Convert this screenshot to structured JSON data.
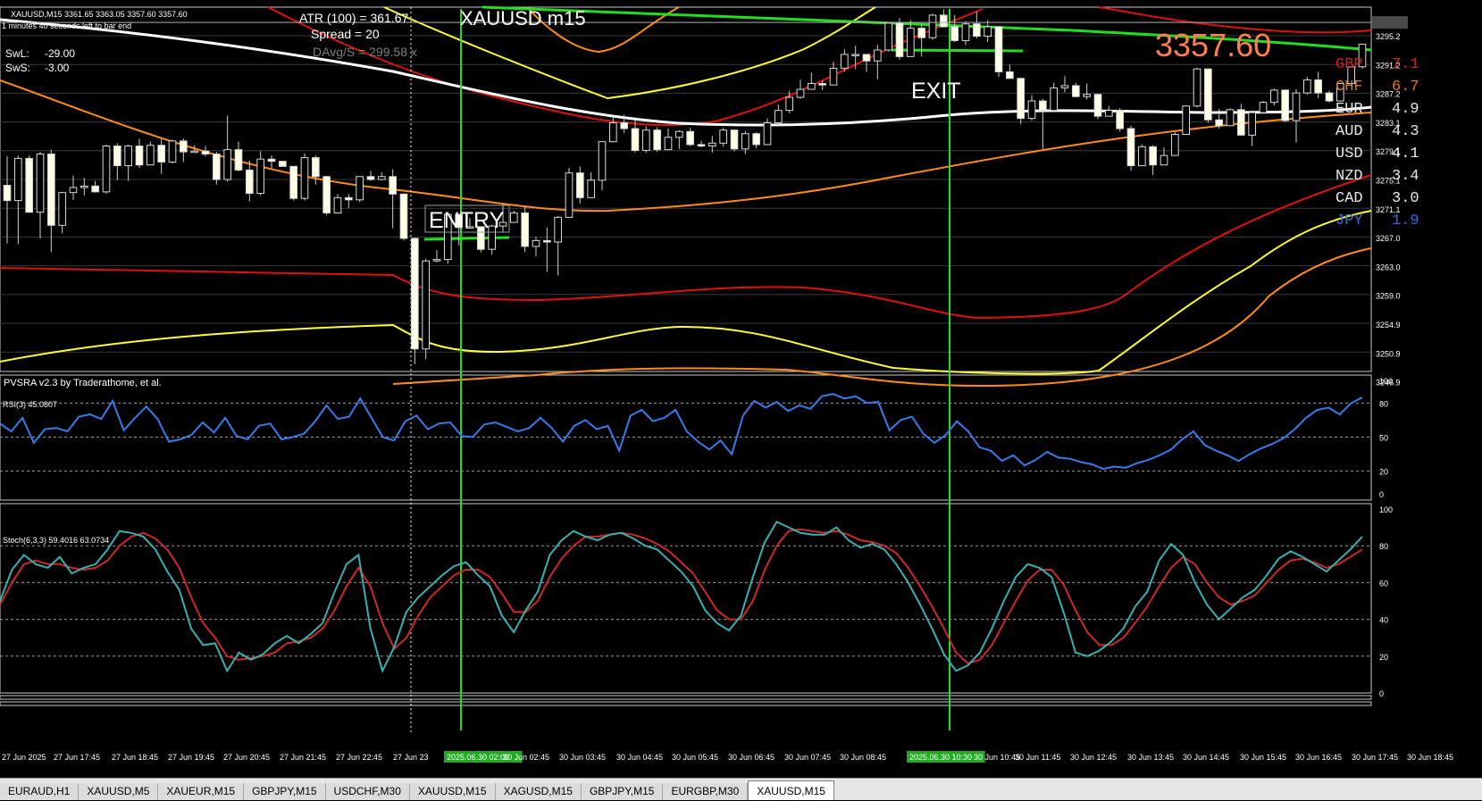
{
  "window": {
    "symbol_header": "XAUUSD,M15  3361.65 3363.05 3357.60 3357.60",
    "bar_timer": "1 minutes 40 seconds left to bar end",
    "big_title": "XAUUSD m15",
    "last_price": "3357.60",
    "indicator_credit": "PVSRA v2.3 by Traderathome, et al."
  },
  "stats": {
    "atr": "ATR (100) = 361.67",
    "spread": "Spread = 20",
    "davg": "DAvg/S = 299.58 x",
    "swl_label": "SwL:",
    "swl_value": "-29.00",
    "sws_label": "SwS:",
    "sws_value": "-3.00"
  },
  "trade_labels": {
    "entry": "ENTRY",
    "exit": "EXIT"
  },
  "currency_strength": [
    {
      "code": "GBP",
      "value": "7.1",
      "color": "#d12020"
    },
    {
      "code": "CHF",
      "value": "6.7",
      "color": "#e07820"
    },
    {
      "code": "EUR",
      "value": "4.9",
      "color": "#e8e8e8"
    },
    {
      "code": "AUD",
      "value": "4.3",
      "color": "#e8e8e8"
    },
    {
      "code": "USD",
      "value": "4.1",
      "color": "#e8e8e8"
    },
    {
      "code": "NZD",
      "value": "3.4",
      "color": "#e8e8e8"
    },
    {
      "code": "CAD",
      "value": "3.0",
      "color": "#e8e8e8"
    },
    {
      "code": "JPY",
      "value": "1.9",
      "color": "#3a6ae0"
    }
  ],
  "price_axis": [
    "3295.2",
    "3291.2",
    "3287.2",
    "3283.1",
    "3279.1",
    "3275.1",
    "3271.1",
    "3267.0",
    "3263.0",
    "3259.0",
    "3254.9",
    "3250.9",
    "3246.9"
  ],
  "rsi": {
    "label": "RSI(3) 45.0807",
    "levels": [
      "100",
      "80",
      "50",
      "20",
      "0"
    ]
  },
  "stoch": {
    "label": "Stoch(6,3,3) 59.4016 63.0734",
    "levels": [
      "100",
      "80",
      "60",
      "40",
      "20",
      "0"
    ]
  },
  "time_axis": [
    "27 Jun 2025",
    "27 Jun 17:45",
    "27 Jun 18:45",
    "27 Jun 19:45",
    "27 Jun 20:45",
    "27 Jun 21:45",
    "27 Jun 22:45",
    "27 Jun 23",
    "2025.06.30 02:00",
    "30 Jun 02:45",
    "30 Jun 03:45",
    "30 Jun 04:45",
    "30 Jun 05:45",
    "30 Jun 06:45",
    "30 Jun 07:45",
    "30 Jun 08:45",
    "2025.06.30 10:30",
    "30 Jun 10:45",
    "30 Jun 11:45",
    "30 Jun 12:45",
    "30 Jun 13:45",
    "30 Jun 14:45",
    "30 Jun 15:45",
    "30 Jun 16:45",
    "30 Jun 17:45",
    "30 Jun 18:45"
  ],
  "tabs": [
    "EURAUD,H1",
    "XAUUSD,M5",
    "XAUEUR,M15",
    "GBPJPY,M15",
    "USDCHF,M30",
    "XAUUSD,M15",
    "XAGUSD,M15",
    "GBPJPY,M15",
    "EURGBP,M30",
    "XAUUSD,M15"
  ],
  "active_tab": 9,
  "chart_data": {
    "type": "candlestick",
    "instrument": "XAUUSD",
    "timeframe": "M15",
    "ylim": [
      3246.9,
      3297.0
    ],
    "candles": [
      [
        3272.5,
        3276.5,
        3264.5,
        3270.4
      ],
      [
        3270.4,
        3276.6,
        3264.4,
        3276.2
      ],
      [
        3276.2,
        3276.6,
        3268.7,
        3268.8
      ],
      [
        3268.8,
        3277.1,
        3265.2,
        3276.8
      ],
      [
        3276.8,
        3277.4,
        3263.3,
        3267.0
      ],
      [
        3267.0,
        3271.6,
        3265.9,
        3271.5
      ],
      [
        3271.5,
        3273.8,
        3270.5,
        3272.2
      ],
      [
        3272.2,
        3273.5,
        3271.1,
        3272.4
      ],
      [
        3272.4,
        3273.1,
        3271.5,
        3271.6
      ],
      [
        3271.6,
        3278.1,
        3271.3,
        3277.9
      ],
      [
        3277.9,
        3278.3,
        3273.2,
        3275.2
      ],
      [
        3275.2,
        3278.1,
        3273.1,
        3277.9
      ],
      [
        3277.9,
        3278.9,
        3274.9,
        3275.3
      ],
      [
        3275.3,
        3278.5,
        3276.5,
        3278.0
      ],
      [
        3278.0,
        3278.9,
        3274.1,
        3275.7
      ],
      [
        3275.7,
        3278.8,
        3275.5,
        3278.6
      ],
      [
        3278.6,
        3278.9,
        3275.7,
        3277.1
      ],
      [
        3277.1,
        3278.0,
        3277.0,
        3277.2
      ],
      [
        3277.2,
        3277.9,
        3276.5,
        3276.8
      ],
      [
        3276.8,
        3277.1,
        3272.6,
        3273.3
      ],
      [
        3273.3,
        3282.1,
        3273.0,
        3277.4
      ],
      [
        3277.4,
        3278.5,
        3274.4,
        3274.6
      ],
      [
        3274.6,
        3275.9,
        3270.3,
        3271.4
      ],
      [
        3271.4,
        3277.2,
        3271.1,
        3276.1
      ],
      [
        3276.1,
        3276.6,
        3274.8,
        3275.8
      ],
      [
        3275.8,
        3275.7,
        3275.2,
        3275.1
      ],
      [
        3275.1,
        3275.1,
        3270.4,
        3270.7
      ],
      [
        3270.7,
        3276.9,
        3270.4,
        3276.3
      ],
      [
        3276.3,
        3276.6,
        3272.6,
        3273.7
      ],
      [
        3273.7,
        3273.8,
        3268.4,
        3268.7
      ],
      [
        3268.7,
        3271.3,
        3270.2,
        3270.8
      ],
      [
        3270.8,
        3271.3,
        3269.4,
        3270.5
      ],
      [
        3270.5,
        3273.7,
        3270.2,
        3273.7
      ],
      [
        3273.7,
        3274.5,
        3273.1,
        3273.3
      ],
      [
        3273.3,
        3274.3,
        3273.2,
        3273.7
      ],
      [
        3273.7,
        3274.7,
        3266.6,
        3271.3
      ],
      [
        3271.3,
        3271.3,
        3264.9,
        3265.2
      ],
      [
        3265.2,
        3265.3,
        3247.9,
        3250.0
      ],
      [
        3250.0,
        3262.4,
        3248.6,
        3262.1
      ],
      [
        3262.1,
        3263.6,
        3261.9,
        3262.3
      ],
      [
        3262.3,
        3268.6,
        3261.7,
        3268.5
      ],
      [
        3268.5,
        3267.1,
        3264.2,
        3266.7
      ],
      [
        3266.7,
        3268.0,
        3266.6,
        3266.8
      ],
      [
        3266.8,
        3266.7,
        3263.3,
        3263.7
      ],
      [
        3263.7,
        3267.1,
        3263.0,
        3266.9
      ],
      [
        3266.9,
        3269.9,
        3266.1,
        3267.4
      ],
      [
        3267.4,
        3269.0,
        3267.8,
        3268.7
      ],
      [
        3268.7,
        3269.7,
        3263.3,
        3264.1
      ],
      [
        3264.1,
        3265.4,
        3262.8,
        3264.9
      ],
      [
        3264.9,
        3266.7,
        3260.6,
        3264.7
      ],
      [
        3264.7,
        3268.3,
        3260.1,
        3268.1
      ],
      [
        3268.1,
        3274.9,
        3268.1,
        3274.2
      ],
      [
        3274.2,
        3275.1,
        3270.0,
        3270.8
      ],
      [
        3270.8,
        3274.3,
        3271.1,
        3273.2
      ],
      [
        3273.2,
        3278.5,
        3271.8,
        3278.5
      ],
      [
        3278.5,
        3282.1,
        3278.4,
        3281.1
      ],
      [
        3281.1,
        3282.2,
        3279.7,
        3280.3
      ],
      [
        3280.3,
        3281.5,
        3277.0,
        3277.3
      ],
      [
        3277.3,
        3280.6,
        3277.0,
        3280.1
      ],
      [
        3280.1,
        3280.5,
        3277.1,
        3277.4
      ],
      [
        3277.4,
        3280.3,
        3277.8,
        3279.1
      ],
      [
        3279.1,
        3280.1,
        3277.5,
        3279.9
      ],
      [
        3279.9,
        3280.4,
        3277.9,
        3278.1
      ],
      [
        3278.1,
        3278.6,
        3277.7,
        3277.9
      ],
      [
        3277.9,
        3279.3,
        3277.0,
        3278.3
      ],
      [
        3278.3,
        3280.4,
        3277.8,
        3280.1
      ],
      [
        3280.1,
        3279.3,
        3277.2,
        3277.5
      ],
      [
        3277.5,
        3280.0,
        3276.8,
        3279.6
      ],
      [
        3279.6,
        3279.8,
        3277.6,
        3278.1
      ],
      [
        3278.1,
        3281.7,
        3278.3,
        3281.1
      ],
      [
        3281.1,
        3283.6,
        3280.7,
        3282.8
      ],
      [
        3282.8,
        3285.5,
        3282.4,
        3284.6
      ],
      [
        3284.6,
        3287.0,
        3284.4,
        3285.7
      ],
      [
        3285.7,
        3288.0,
        3286.0,
        3286.5
      ],
      [
        3286.5,
        3286.9,
        3285.6,
        3286.3
      ],
      [
        3286.3,
        3289.5,
        3286.3,
        3288.6
      ],
      [
        3288.6,
        3291.2,
        3288.1,
        3290.5
      ],
      [
        3290.5,
        3291.7,
        3288.5,
        3290.5
      ],
      [
        3290.5,
        3290.4,
        3288.1,
        3289.6
      ],
      [
        3289.6,
        3291.8,
        3287.1,
        3291.1
      ],
      [
        3291.1,
        3294.9,
        3290.9,
        3294.8
      ],
      [
        3294.8,
        3295.5,
        3289.8,
        3290.2
      ],
      [
        3290.2,
        3295.2,
        3290.6,
        3294.1
      ],
      [
        3294.1,
        3294.6,
        3290.2,
        3292.8
      ],
      [
        3292.8,
        3296.1,
        3292.5,
        3295.9
      ],
      [
        3295.9,
        3296.7,
        3294.2,
        3294.3
      ],
      [
        3294.3,
        3295.9,
        3292.2,
        3292.4
      ],
      [
        3292.4,
        3295.1,
        3291.8,
        3294.7
      ],
      [
        3294.7,
        3296.4,
        3292.7,
        3293.0
      ],
      [
        3293.0,
        3295.2,
        3292.2,
        3294.3
      ],
      [
        3294.3,
        3292.8,
        3287.4,
        3288.1
      ],
      [
        3288.1,
        3289.1,
        3287.3,
        3287.2
      ],
      [
        3287.2,
        3287.3,
        3280.9,
        3281.7
      ],
      [
        3281.7,
        3284.9,
        3281.4,
        3284.1
      ],
      [
        3284.1,
        3284.4,
        3277.5,
        3282.8
      ],
      [
        3282.8,
        3286.6,
        3282.6,
        3285.9
      ],
      [
        3285.9,
        3287.5,
        3285.3,
        3286.2
      ],
      [
        3286.2,
        3286.6,
        3284.6,
        3284.7
      ],
      [
        3284.7,
        3286.5,
        3284.3,
        3285.0
      ],
      [
        3285.0,
        3285.1,
        3281.6,
        3282.0
      ],
      [
        3282.0,
        3283.4,
        3282.1,
        3282.8
      ],
      [
        3282.8,
        3283.1,
        3279.9,
        3280.3
      ],
      [
        3280.3,
        3280.7,
        3274.5,
        3275.2
      ],
      [
        3275.2,
        3278.1,
        3275.3,
        3277.8
      ],
      [
        3277.8,
        3278.0,
        3273.9,
        3275.3
      ],
      [
        3275.3,
        3277.7,
        3275.4,
        3276.6
      ],
      [
        3276.6,
        3279.8,
        3276.7,
        3279.5
      ],
      [
        3279.5,
        3283.5,
        3279.5,
        3283.4
      ],
      [
        3283.4,
        3288.7,
        3283.2,
        3288.5
      ],
      [
        3288.5,
        3286.4,
        3281.1,
        3281.5
      ],
      [
        3281.5,
        3283.0,
        3280.3,
        3280.7
      ],
      [
        3280.7,
        3283.1,
        3280.6,
        3282.9
      ],
      [
        3282.9,
        3283.7,
        3279.4,
        3279.4
      ],
      [
        3279.4,
        3282.8,
        3277.9,
        3282.5
      ],
      [
        3282.5,
        3284.1,
        3282.4,
        3283.9
      ],
      [
        3283.9,
        3285.8,
        3283.5,
        3285.6
      ],
      [
        3285.6,
        3285.6,
        3281.2,
        3281.4
      ],
      [
        3281.4,
        3285.7,
        3278.4,
        3285.2
      ],
      [
        3285.2,
        3287.4,
        3285.0,
        3287.0
      ],
      [
        3287.0,
        3288.1,
        3284.5,
        3285.2
      ],
      [
        3285.2,
        3285.5,
        3283.9,
        3284.1
      ],
      [
        3284.1,
        3286.6,
        3284.0,
        3286.5
      ],
      [
        3286.5,
        3288.9,
        3286.4,
        3288.8
      ],
      [
        3288.8,
        3291.9,
        3288.5,
        3291.9
      ]
    ],
    "rsi_values": [
      62,
      55,
      67,
      45,
      57,
      58,
      55,
      68,
      70,
      66,
      82,
      56,
      67,
      77,
      66,
      46,
      48,
      52,
      63,
      54,
      67,
      51,
      48,
      60,
      62,
      48,
      50,
      53,
      64,
      78,
      66,
      68,
      84,
      67,
      50,
      47,
      64,
      69,
      57,
      62,
      63,
      51,
      50,
      61,
      63,
      59,
      55,
      58,
      67,
      58,
      46,
      60,
      65,
      57,
      60,
      38,
      69,
      74,
      64,
      67,
      74,
      55,
      46,
      39,
      47,
      35,
      69,
      82,
      76,
      81,
      73,
      78,
      75,
      86,
      88,
      84,
      86,
      80,
      81,
      56,
      65,
      68,
      53,
      45,
      52,
      64,
      55,
      41,
      38,
      29,
      34,
      25,
      30,
      37,
      32,
      31,
      28,
      26,
      22,
      24,
      23,
      27,
      30,
      34,
      39,
      48,
      55,
      43,
      38,
      34,
      29,
      35,
      40,
      44,
      49,
      57,
      67,
      74,
      76,
      70,
      80,
      85
    ],
    "stoch_main": [
      50,
      67,
      75,
      70,
      68,
      74,
      65,
      68,
      70,
      78,
      88,
      87,
      85,
      78,
      66,
      56,
      35,
      26,
      27,
      12,
      22,
      18,
      21,
      27,
      31,
      27,
      32,
      38,
      55,
      70,
      75,
      35,
      12,
      25,
      44,
      52,
      58,
      64,
      69,
      71,
      64,
      58,
      42,
      33,
      45,
      55,
      75,
      83,
      88,
      85,
      83,
      86,
      87,
      84,
      80,
      78,
      72,
      66,
      58,
      45,
      38,
      34,
      42,
      63,
      82,
      93,
      90,
      87,
      86,
      86,
      90,
      83,
      79,
      81,
      78,
      70,
      60,
      48,
      35,
      21,
      12,
      15,
      22,
      35,
      50,
      63,
      70,
      68,
      63,
      44,
      22,
      20,
      23,
      28,
      35,
      47,
      55,
      72,
      81,
      75,
      60,
      48,
      40,
      46,
      52,
      56,
      64,
      73,
      77,
      74,
      70,
      66,
      72,
      78,
      85
    ],
    "stoch_signal": [
      48,
      60,
      70,
      72,
      70,
      70,
      68,
      67,
      68,
      72,
      80,
      85,
      87,
      84,
      78,
      68,
      52,
      38,
      30,
      20,
      18,
      19,
      20,
      22,
      27,
      28,
      30,
      35,
      45,
      58,
      68,
      58,
      38,
      24,
      30,
      42,
      52,
      58,
      64,
      67,
      67,
      63,
      54,
      44,
      44,
      50,
      63,
      73,
      80,
      85,
      85,
      86,
      87,
      86,
      84,
      81,
      77,
      71,
      65,
      55,
      45,
      40,
      40,
      50,
      67,
      80,
      88,
      89,
      88,
      87,
      88,
      86,
      83,
      82,
      80,
      76,
      68,
      58,
      47,
      35,
      22,
      16,
      18,
      26,
      38,
      50,
      61,
      67,
      67,
      59,
      45,
      33,
      26,
      26,
      30,
      38,
      47,
      58,
      68,
      74,
      70,
      60,
      52,
      48,
      50,
      53,
      60,
      67,
      72,
      73,
      71,
      68,
      70,
      74,
      78
    ]
  }
}
